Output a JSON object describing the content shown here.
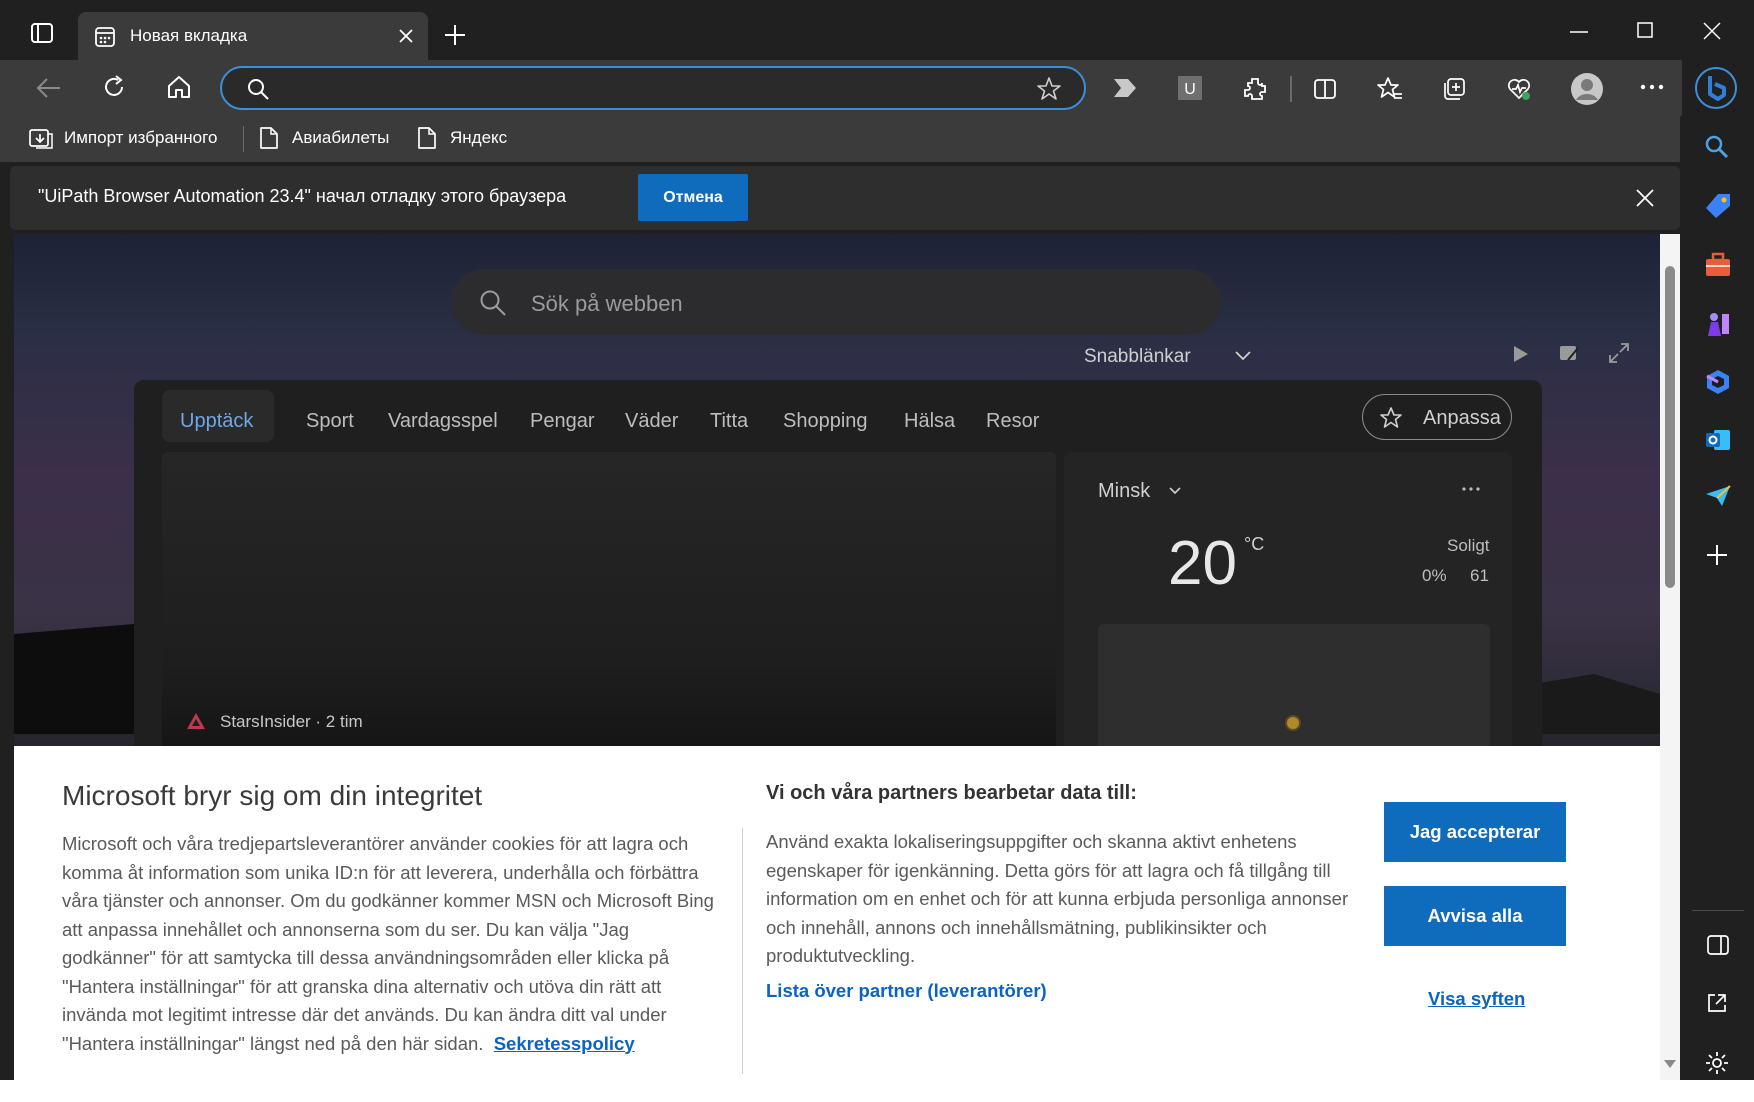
{
  "browser": {
    "tab_title": "Новая вкладка",
    "favorites": [
      {
        "label": "Импорт избранного"
      },
      {
        "label": "Авиабилеты"
      },
      {
        "label": "Яндекс"
      }
    ],
    "infobar": {
      "message": "\"UiPath Browser Automation 23.4\" начал отладку этого браузера",
      "cancel_label": "Отмена"
    },
    "accent_color": "#0f6cbd"
  },
  "newtab": {
    "search_placeholder": "Sök på webben",
    "quick_links_label": "Snabblänkar",
    "nav_tabs": [
      "Upptäck",
      "Sport",
      "Vardagsspel",
      "Pengar",
      "Väder",
      "Titta",
      "Shopping",
      "Hälsa",
      "Resor"
    ],
    "customize_label": "Anpassa",
    "hero_source": "StarsInsider · 2 tim",
    "weather": {
      "city": "Minsk",
      "temp": "20",
      "unit": "°C",
      "condition": "Soligt",
      "precip": "0%",
      "humidity": "61"
    }
  },
  "cookie": {
    "title": "Microsoft bryr sig om din integritet",
    "body": "Microsoft och våra tredjepartsleverantörer använder cookies för att lagra och komma åt information som unika ID:n för att leverera, underhålla och förbättra våra tjänster och annonser. Om du godkänner kommer MSN och Microsoft Bing att anpassa innehållet och annonserna som du ser. Du kan välja \"Jag godkänner\" för att samtycka till dessa användningsområden eller klicka på \"Hantera inställningar\" för att granska dina alternativ och utöva din rätt att invända mot legitimt intresse där det används. Du kan ändra ditt val under \"Hantera inställningar\" längst ned på den här sidan.",
    "privacy_link": "Sekretesspolicy",
    "title2": "Vi och våra partners bearbetar data till:",
    "body2": "Använd exakta lokaliseringsuppgifter och skanna aktivt enhetens egenskaper för igenkänning. Detta görs för att lagra och få tillgång till information om en enhet och för att kunna erbjuda personliga annonser och innehåll, annons och innehållsmätning, publikinsikter och produktutveckling.",
    "partners_link": "Lista över partner (leverantörer)",
    "accept_label": "Jag accepterar",
    "reject_label": "Avvisa alla",
    "purposes_link": "Visa syften"
  }
}
